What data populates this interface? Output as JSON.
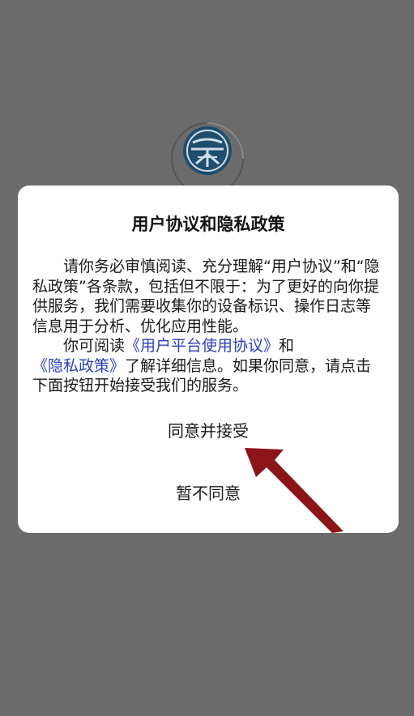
{
  "dialog": {
    "title": "用户协议和隐私政策",
    "para1": "请你务必审慎阅读、充分理解“用户协议”和“隐私政策”各条款，包括但不限于：为了更好的向你提供服务，我们需要收集你的设备标识、操作日志等信息用于分析、优化应用性能。",
    "para2_prefix": "你可阅读",
    "link_user_agreement": "《用户平台使用协议》",
    "para2_and": "和",
    "link_privacy_policy": "《隐私政策》",
    "para2_suffix": "了解详细信息。如果你同意，请点击下面按钮开始接受我们的服务。",
    "agree_label": "同意并接受",
    "disagree_label": "暂不同意"
  },
  "colors": {
    "overlay": "#6b6b6b",
    "link": "#2a40b8",
    "arrow": "#8b1418",
    "logo": "#1e4d6e"
  },
  "icons": {
    "logo": "university-seal-icon",
    "loading": "loading-spinner-icon",
    "annotation": "red-arrow-annotation"
  }
}
